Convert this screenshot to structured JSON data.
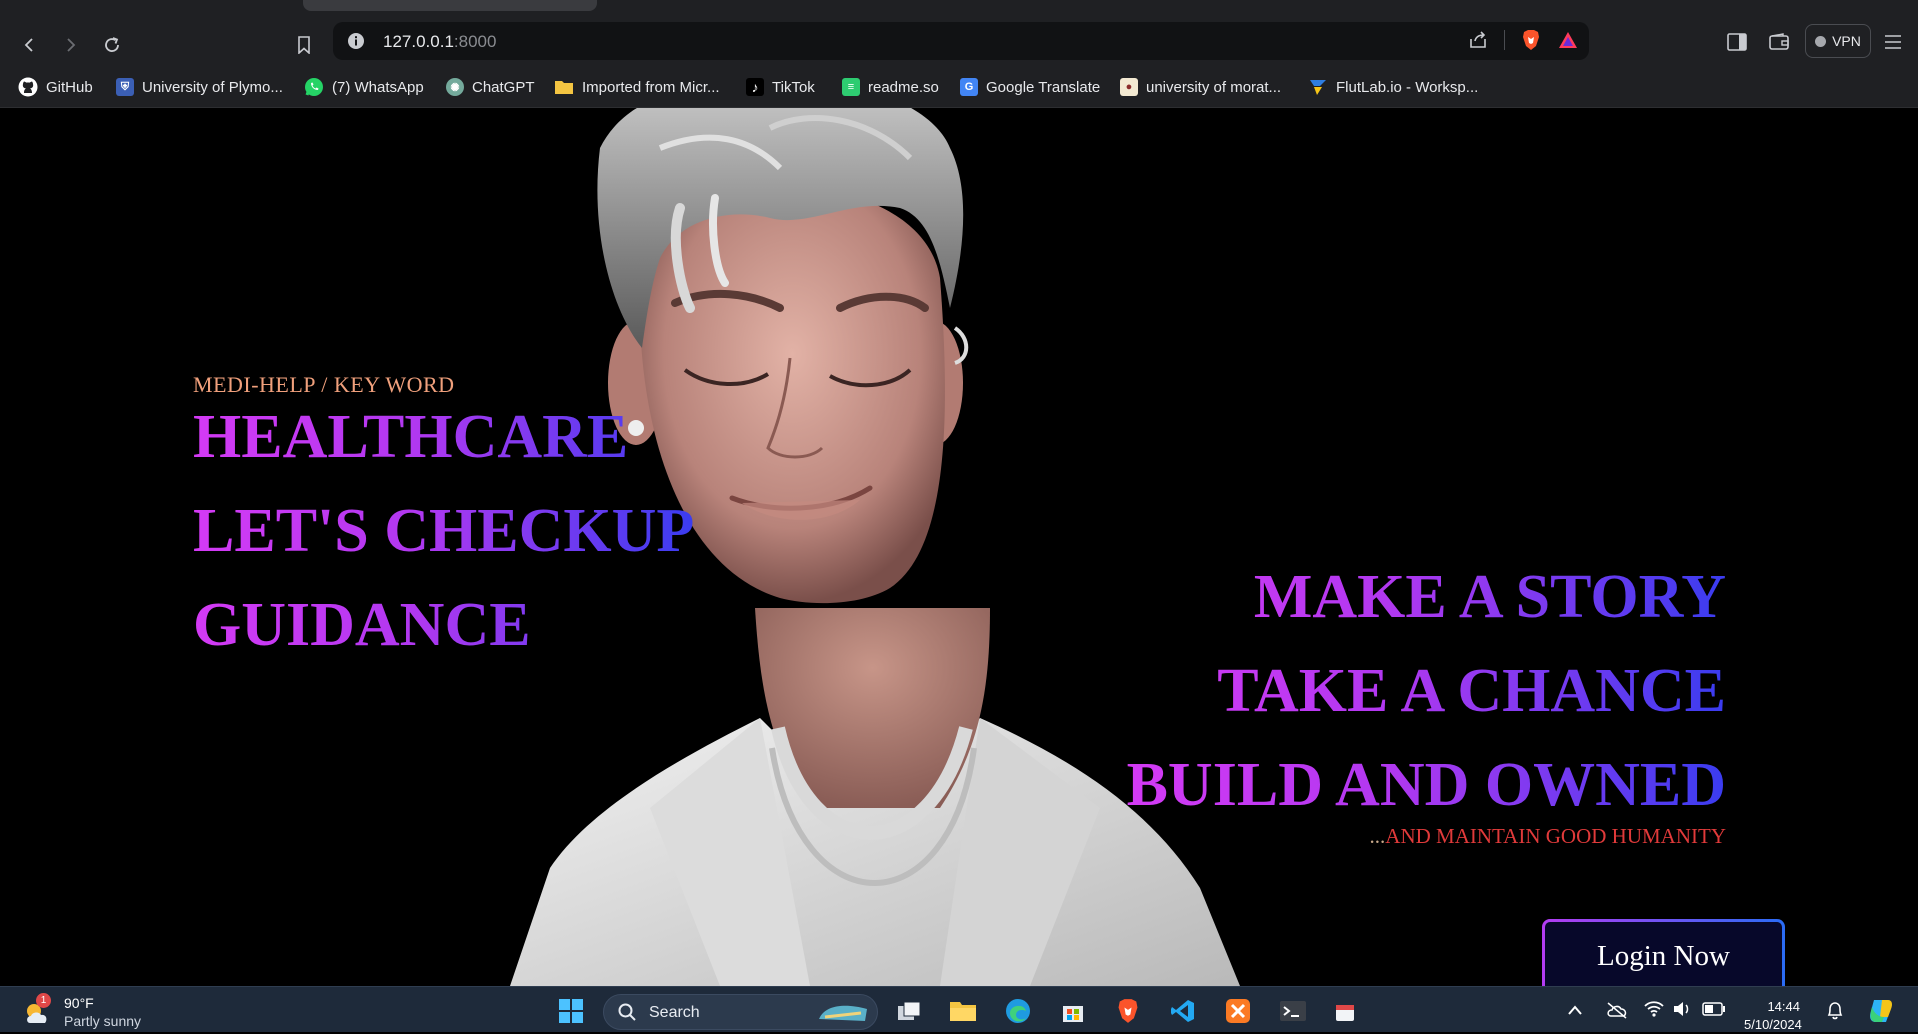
{
  "browser": {
    "url_host": "127.0.0.1",
    "url_port": ":8000",
    "vpn_label": "VPN"
  },
  "bookmarks": [
    {
      "label": "GitHub",
      "icon": "github-icon",
      "color": "#ffffff"
    },
    {
      "label": "University of Plymo...",
      "icon": "university-crest-icon",
      "color": "#3b5fb5"
    },
    {
      "label": "(7) WhatsApp",
      "icon": "whatsapp-icon",
      "color": "#25d366"
    },
    {
      "label": "ChatGPT",
      "icon": "chatgpt-icon",
      "color": "#74aa9c"
    },
    {
      "label": "Imported from Micr...",
      "icon": "folder-icon",
      "color": "#f4c542"
    },
    {
      "label": "TikTok",
      "icon": "tiktok-icon",
      "color": "#000000"
    },
    {
      "label": "readme.so",
      "icon": "readme-icon",
      "color": "#2ecc71"
    },
    {
      "label": "Google Translate",
      "icon": "google-translate-icon",
      "color": "#4285f4"
    },
    {
      "label": "university of morat...",
      "icon": "moratuwa-crest-icon",
      "color": "#8b2b2b"
    },
    {
      "label": "FlutLab.io - Worksp...",
      "icon": "flutlab-icon",
      "color": "#2e7de0"
    }
  ],
  "hero": {
    "keyword": "MEDI-HELP / KEY WORD",
    "left_lines": [
      "HEALTHCARE",
      "LET'S CHECKUP",
      "GUIDANCE"
    ],
    "right_lines": [
      "MAKE A STORY",
      "TAKE A CHANCE",
      "BUILD AND OWNED"
    ],
    "tagline_dots": "...",
    "tagline": "AND MAINTAIN GOOD HUMANITY",
    "login_label": "Login Now"
  },
  "taskbar": {
    "temperature": "90°F",
    "weather": "Partly sunny",
    "weather_badge": "1",
    "search_label": "Search",
    "time": "14:44",
    "date": "5/10/2024"
  },
  "colors": {
    "gradient_start": "#d43af5",
    "gradient_end": "#3a3cf0",
    "keyword": "#f0a07c",
    "tagline": "#e03a3a"
  }
}
